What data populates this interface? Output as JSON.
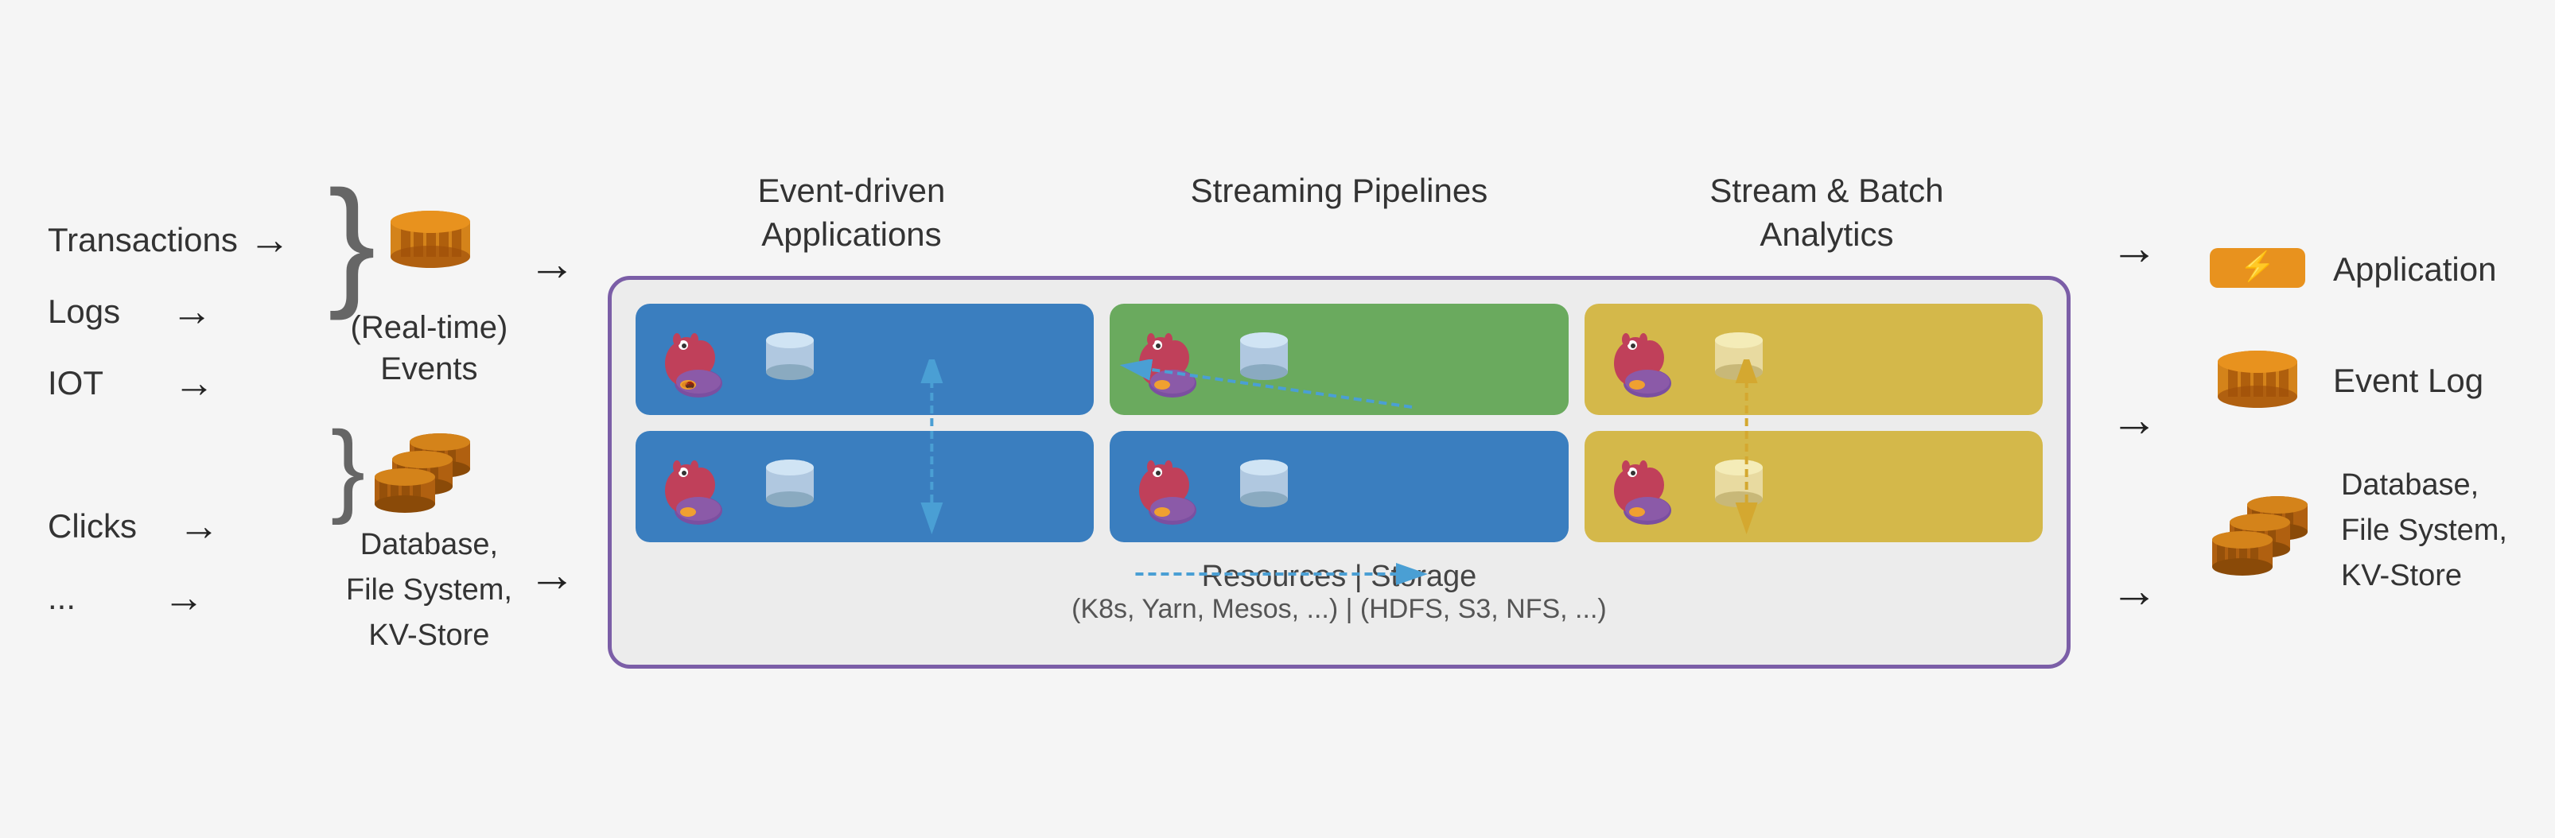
{
  "inputs": {
    "items": [
      "Transactions",
      "Logs",
      "IOT",
      "Clicks",
      "..."
    ]
  },
  "realtime_label": "(Real-time)\nEvents",
  "db_label": "Database,\nFile System,\nKV-Store",
  "column_headers": {
    "col1": "Event-driven\nApplications",
    "col2": "Streaming\nPipelines",
    "col3": "Stream & Batch\nAnalytics"
  },
  "resources_label": "Resources | Storage",
  "resources_sub": "(K8s, Yarn, Mesos, ...) | (HDFS, S3, NFS, ...)",
  "outputs": {
    "app_label": "Application",
    "event_log_label": "Event Log",
    "db_label": "Database,\nFile System,\nKV-Store"
  }
}
